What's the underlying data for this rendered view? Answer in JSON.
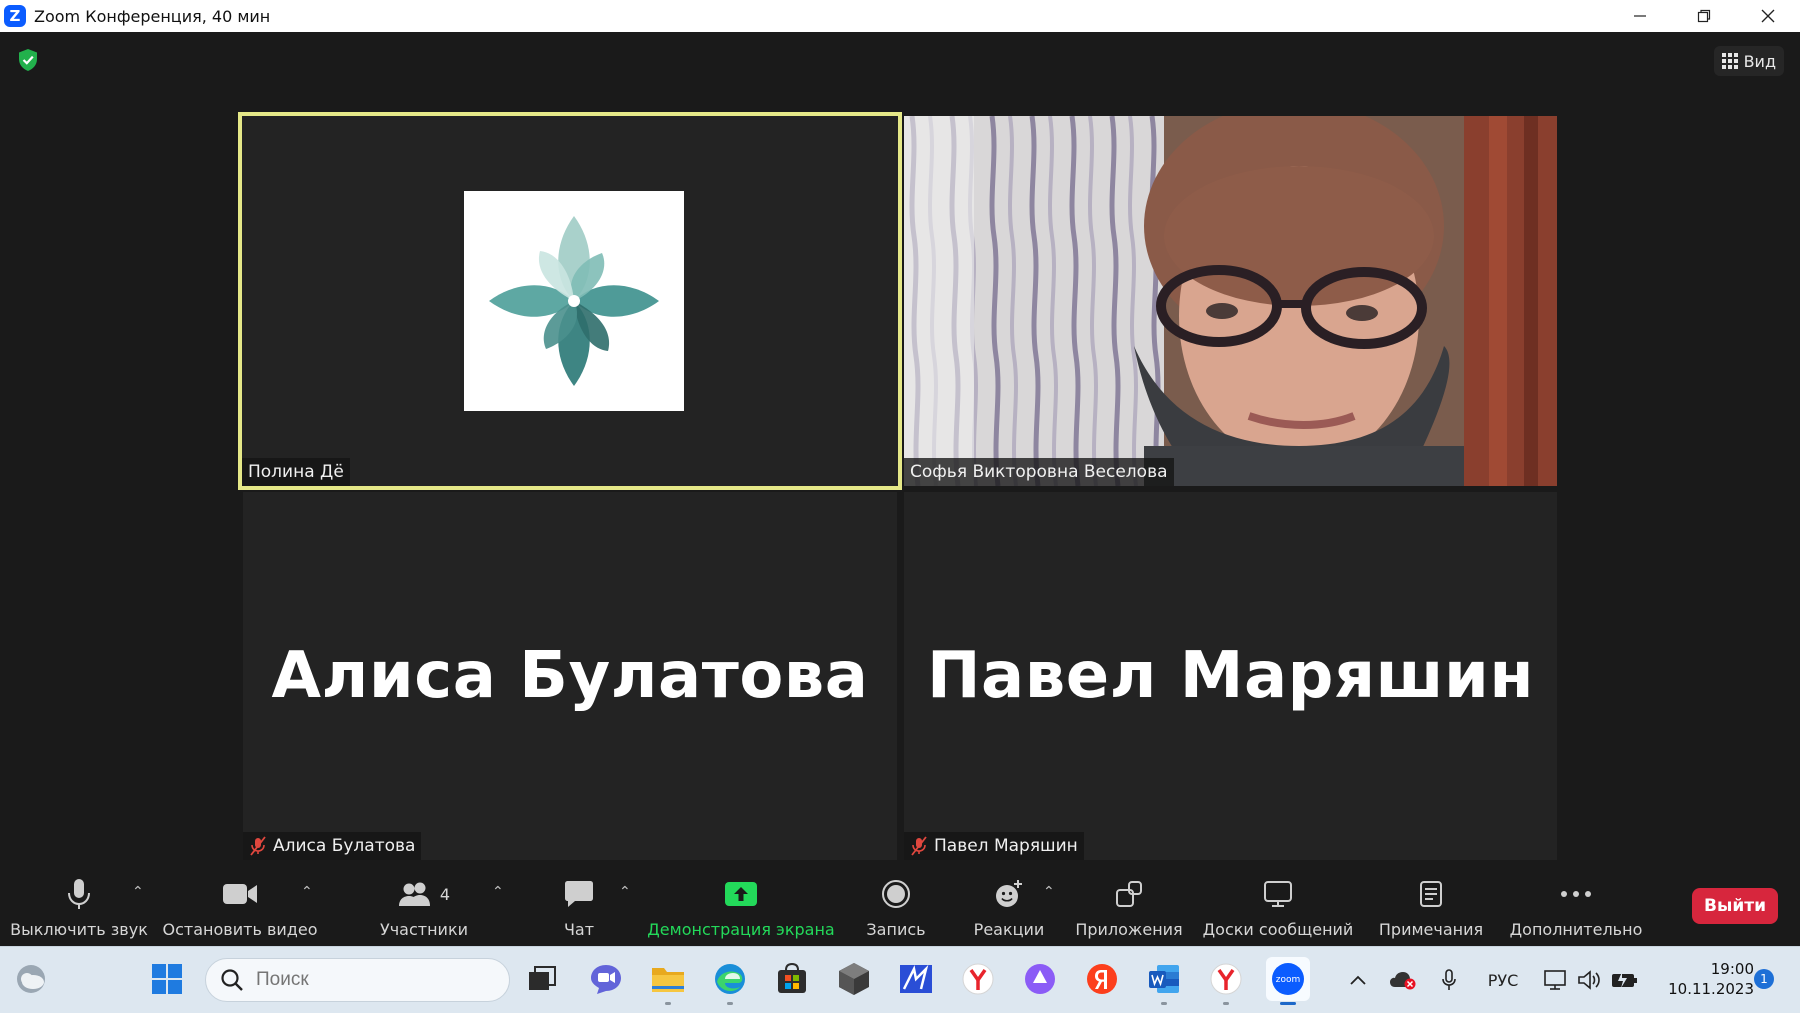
{
  "window": {
    "title": "Zoom Конференция, 40 мин",
    "app_logo_letter": "Z"
  },
  "header": {
    "view_label": "Вид"
  },
  "participants": [
    {
      "name": "Полина Дё",
      "display_name": "",
      "speaking": true,
      "muted": false,
      "video": "logo"
    },
    {
      "name": "Софья Викторовна Веселова",
      "display_name": "",
      "speaking": false,
      "muted": false,
      "video": "camera"
    },
    {
      "name": "Алиса Булатова",
      "display_name": "Алиса Булатова",
      "speaking": false,
      "muted": true,
      "video": "off"
    },
    {
      "name": "Павел Маряшин",
      "display_name": "Павел Маряшин",
      "speaking": false,
      "muted": true,
      "video": "off"
    }
  ],
  "toolbar": {
    "mute_label": "Выключить звук",
    "video_label": "Остановить видео",
    "participants_label": "Участники",
    "participants_count": "4",
    "chat_label": "Чат",
    "share_label": "Демонстрация экрана",
    "record_label": "Запись",
    "reactions_label": "Реакции",
    "apps_label": "Приложения",
    "whiteboards_label": "Доски сообщений",
    "notes_label": "Примечания",
    "more_label": "Дополнительно",
    "leave_label": "Выйти"
  },
  "taskbar": {
    "search_placeholder": "Поиск",
    "language": "РУС",
    "time": "19:00",
    "date": "10.11.2023",
    "notification_count": "1",
    "zoom_app_label": "zoom"
  },
  "colors": {
    "accent_active_border": "#e5e888",
    "share_green": "#23d95a",
    "leave_red": "#d7263d",
    "mute_red": "#e0473e"
  }
}
